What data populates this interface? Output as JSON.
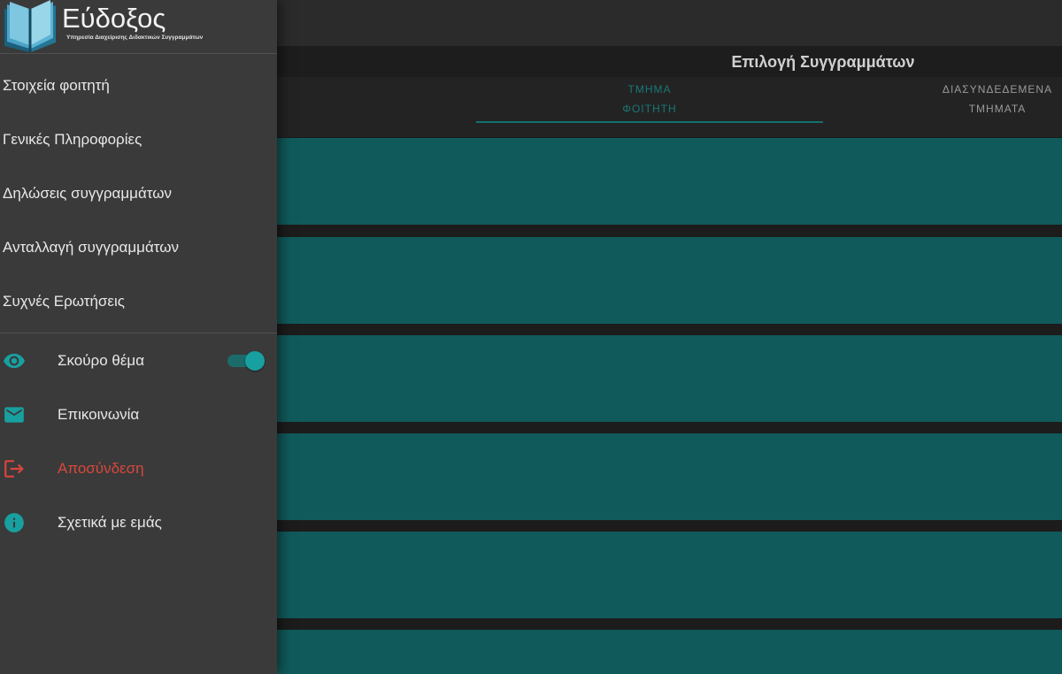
{
  "app": {
    "logo_title": "Εύδοξος",
    "logo_subtitle": "Υπηρεσία Διαχείρισης Διδακτικών Συγγραμμάτων",
    "logo_icon": "open-book-icon"
  },
  "drawer": {
    "menu": [
      {
        "label": "Στοιχεία φοιτητή"
      },
      {
        "label": "Γενικές Πληροφορίες"
      },
      {
        "label": "Δηλώσεις συγγραμμάτων"
      },
      {
        "label": "Ανταλλαγή συγγραμμάτων"
      },
      {
        "label": "Συχνές Ερωτήσεις"
      }
    ],
    "actions": [
      {
        "label": "Σκούρο θέμα",
        "icon": "eye-icon",
        "toggle_on": true
      },
      {
        "label": "Επικοινωνία",
        "icon": "mail-icon"
      },
      {
        "label": "Αποσύνδεση",
        "icon": "logout-icon"
      },
      {
        "label": "Σχετικά με εμάς",
        "icon": "info-icon"
      }
    ]
  },
  "main": {
    "title": "Επιλογή Συγγραμμάτων",
    "tabs": [
      {
        "line1": "ΤΜΗΜΑ",
        "line2": "ΦΟΙΤΗΤΗ",
        "active": true
      },
      {
        "line1": "ΔΙΑΣΥΝΔΕΔΕΜΕΝΑ",
        "line2": "ΤΜΗΜΑΤΑ",
        "active": false
      }
    ]
  },
  "colors": {
    "accent": "#18a0a0",
    "danger": "#d8473d",
    "card": "#115a5b",
    "drawer_bg": "#3a3a3a"
  }
}
